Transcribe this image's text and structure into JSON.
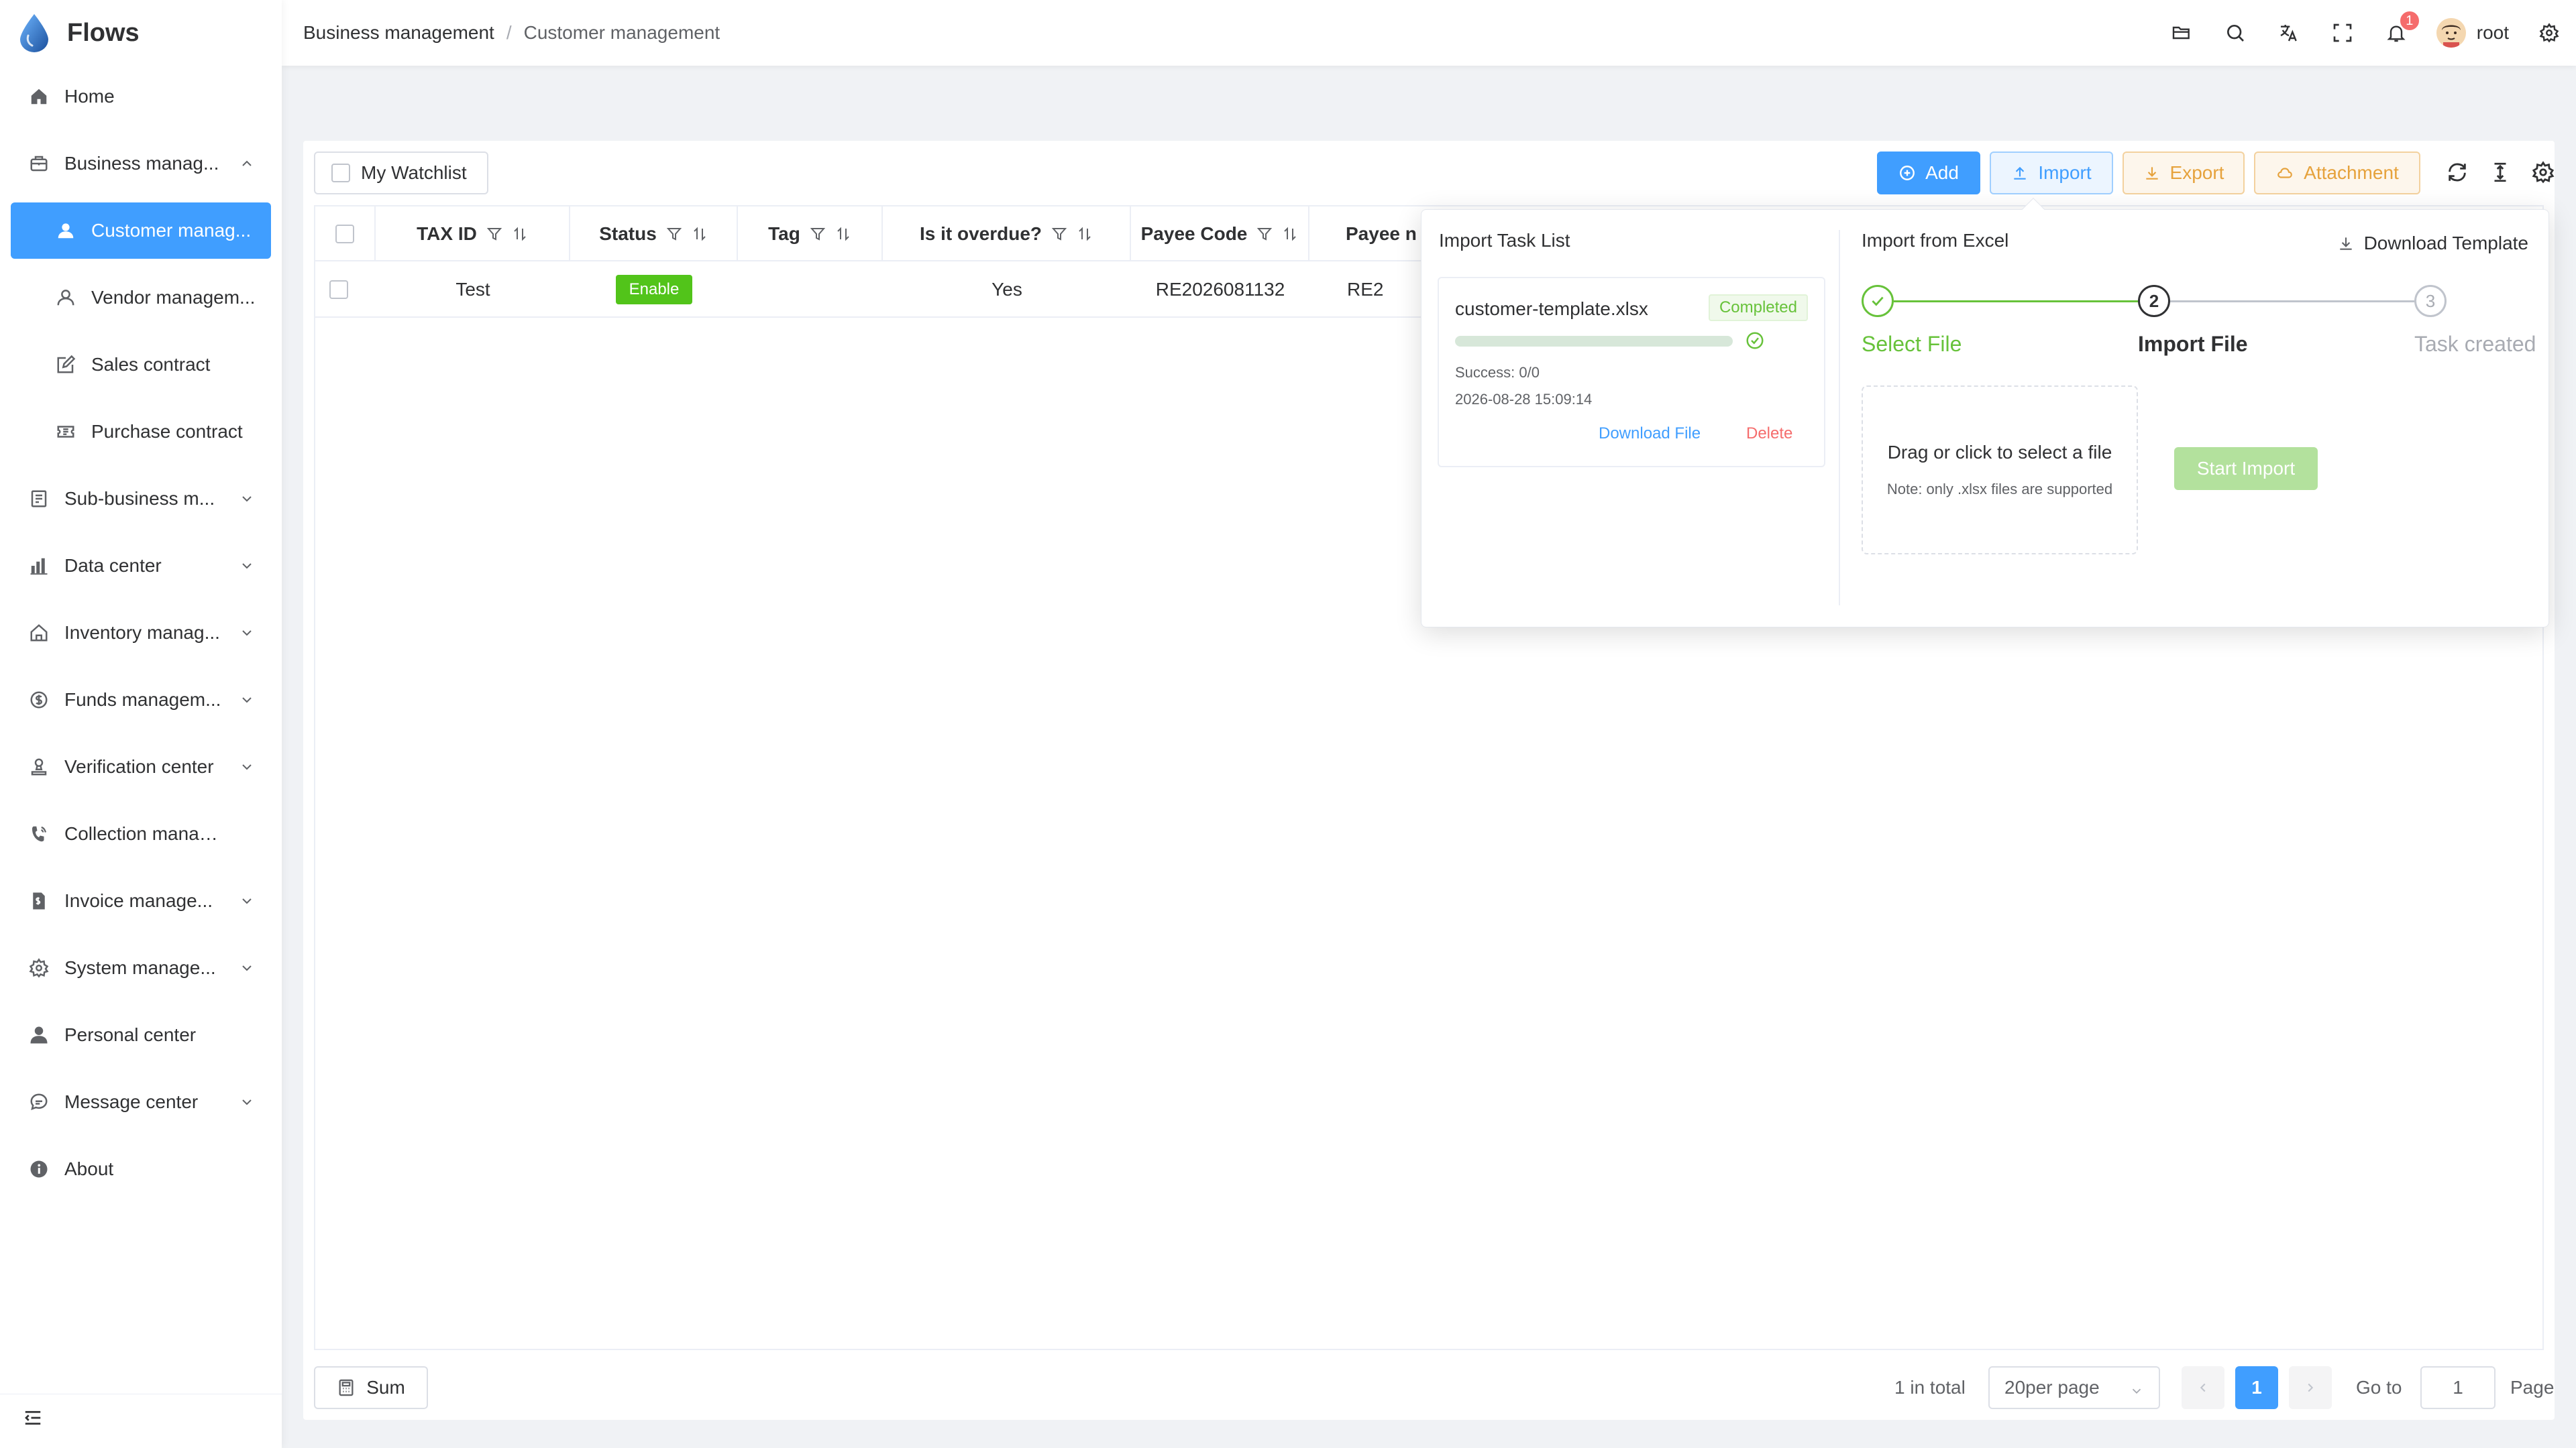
{
  "app": {
    "title": "Flows"
  },
  "sidebar": {
    "items": [
      {
        "label": "Home",
        "icon": "home-icon"
      },
      {
        "label": "Business manag...",
        "icon": "briefcase-icon"
      },
      {
        "label": "Customer manag...",
        "icon": "user-icon"
      },
      {
        "label": "Vendor managem...",
        "icon": "user-outline-icon"
      },
      {
        "label": "Sales contract",
        "icon": "edit-doc-icon"
      },
      {
        "label": "Purchase contract",
        "icon": "ticket-icon"
      },
      {
        "label": "Sub-business m...",
        "icon": "doc-icon"
      },
      {
        "label": "Data center",
        "icon": "chart-icon"
      },
      {
        "label": "Inventory manag...",
        "icon": "house-icon"
      },
      {
        "label": "Funds managem...",
        "icon": "coin-icon"
      },
      {
        "label": "Verification center",
        "icon": "stamp-icon"
      },
      {
        "label": "Collection managem...",
        "icon": "phone-icon"
      },
      {
        "label": "Invoice manage...",
        "icon": "invoice-icon"
      },
      {
        "label": "System manage...",
        "icon": "settings-icon"
      },
      {
        "label": "Personal center",
        "icon": "person-icon"
      },
      {
        "label": "Message center",
        "icon": "chat-icon"
      },
      {
        "label": "About",
        "icon": "info-icon"
      }
    ]
  },
  "header": {
    "breadcrumb": [
      "Business management",
      "Customer management"
    ],
    "separator": "/",
    "notification_count": "1",
    "username": "root"
  },
  "toolbar": {
    "watchlist_label": "My Watchlist",
    "add_label": "Add",
    "import_label": "Import",
    "export_label": "Export",
    "attachment_label": "Attachment"
  },
  "table": {
    "columns": [
      "TAX ID",
      "Status",
      "Tag",
      "Is it overdue?",
      "Payee Code",
      "Payee n"
    ],
    "rows": [
      {
        "tax_id": "Test",
        "status": "Enable",
        "tag": "",
        "overdue": "Yes",
        "payee_code": "RE2026081132",
        "payee_name": "RE2"
      }
    ]
  },
  "footer": {
    "sum_label": "Sum",
    "total_text": "1 in total",
    "page_size": "20per page",
    "current_page": "1",
    "goto_label": "Go to",
    "goto_value": "1",
    "page_label": "Page"
  },
  "import_popover": {
    "task_list_title": "Import Task List",
    "task": {
      "file_name": "customer-template.xlsx",
      "status": "Completed",
      "progress": 1.0,
      "success": "Success: 0/0",
      "timestamp": "2026-08-28 15:09:14",
      "download_label": "Download File",
      "delete_label": "Delete"
    },
    "excel_title": "Import from Excel",
    "download_template_label": "Download Template",
    "steps": [
      {
        "number": "1",
        "label": "Select File",
        "state": "done"
      },
      {
        "number": "2",
        "label": "Import File",
        "state": "active"
      },
      {
        "number": "3",
        "label": "Task created",
        "state": "pending"
      }
    ],
    "dropzone_text": "Drag or click to select a file",
    "dropzone_note": "Note: only .xlsx files are supported",
    "start_label": "Start Import"
  },
  "colors": {
    "primary": "#409eff",
    "success": "#67c23a",
    "warning": "#e6a23c",
    "danger": "#f56c6c",
    "enable_tag": "#52c41a"
  }
}
